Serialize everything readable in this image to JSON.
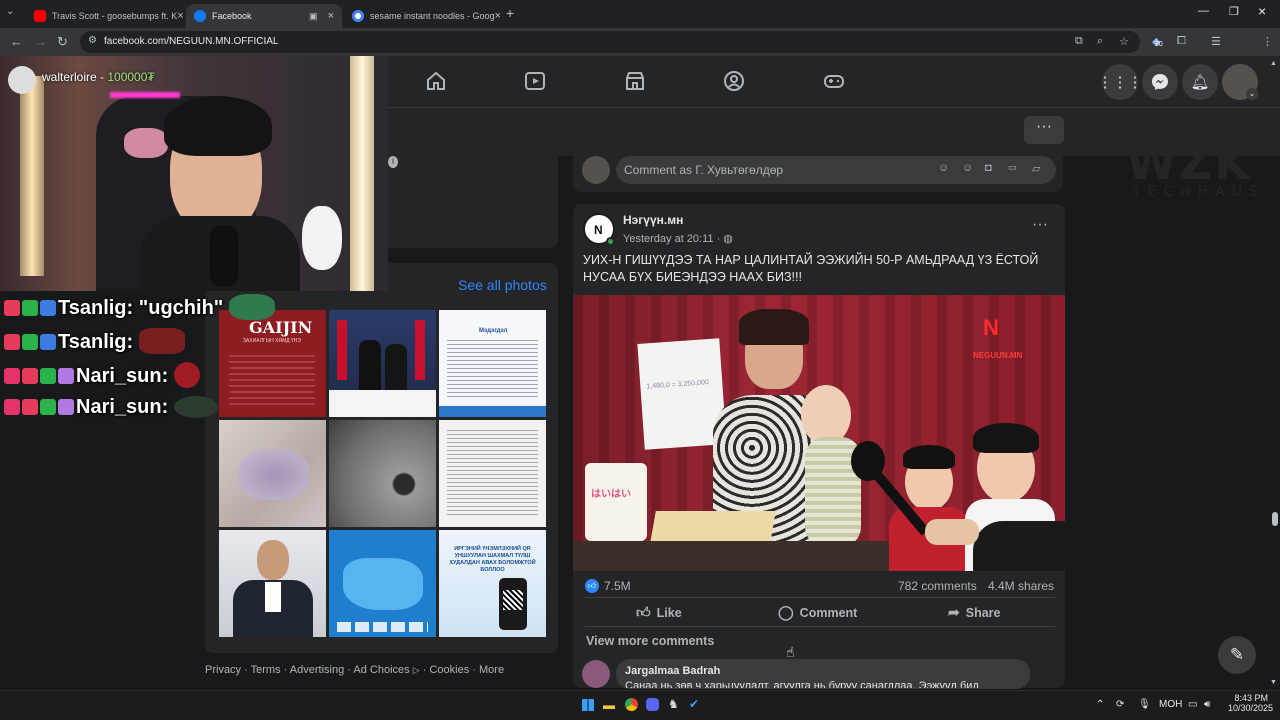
{
  "browser": {
    "tabs": [
      {
        "title": "Travis Scott - goosebumps ft. K",
        "favicon_color": "#ff0000"
      },
      {
        "title": "Facebook",
        "favicon_color": "#1877f2"
      },
      {
        "title": "sesame instant noodles - Goog",
        "favicon_color": "#4285f4"
      }
    ],
    "new_tab": "+",
    "url": "facebook.com/NEGUUN.MN.OFFICIAL",
    "extension_badge": "30"
  },
  "webcam": {
    "streamer": "walterloire",
    "balance": "100000₮"
  },
  "stream_chat": [
    {
      "user": "Tsanlig:",
      "message": "\"ugchih\""
    },
    {
      "user": "Tsanlig:",
      "message": ""
    },
    {
      "user": "Nari_sun:",
      "message": ""
    },
    {
      "user": "Nari_sun:",
      "message": ""
    }
  ],
  "photos_card": {
    "see_all": "See all photos",
    "tile1_brand": "GAIJIN",
    "tile1_sub": "ЗАХИАЛГЫН ХЯМД ҮНЭ",
    "tile3_title": "Мэдэгдэл",
    "tile8_title": "ЖАГСААЛТ",
    "tile9_title": "ИРГЭНИЙ ҮНЭМЛЭХНИЙ QR УНШУУЛАН ШАХМАЛ ТҮЛШ ХУДАЛДАН АВАХ БОЛОМЖТОЙ БОЛЛОО"
  },
  "footer": {
    "links": [
      "Privacy",
      "Terms",
      "Advertising",
      "Ad Choices",
      "Cookies",
      "More"
    ],
    "separator": "·"
  },
  "comment_box": {
    "placeholder": "Comment as Г. Хувьтөгөлдөр"
  },
  "post": {
    "page_name": "Нэгүүн.мн",
    "time": "Yesterday at 20:11",
    "text": "УИХ-Н ГИШҮҮДЭЭ ТА НАР ЦАЛИНТАЙ ЭЭЖИЙН 50-Р АМЬДРААД ҮЗ ЁСТОЙ НУСАА БҮХ БИЕЭНДЭЭ НААХ БИЗ!!!",
    "watermark": "NEGUUN.MN",
    "paper_text": "1,480,0 = 3,250,000",
    "can_label": "はいはい",
    "reactions": "7.5M",
    "comments": "782 comments",
    "shares": "4.4M shares",
    "actions": {
      "like": "Like",
      "comment": "Comment",
      "share": "Share"
    },
    "view_more": "View more comments",
    "top_comment": {
      "author": "Jargalmaa Badrah",
      "text": "Санаа нь зөв ч харьцуулалт, агуулга нь буруу санагдлаа. Ээжүүд бид"
    }
  },
  "watermark_right": {
    "line1": "WZK",
    "line2": "TECHHAUS"
  },
  "taskbar": {
    "lang": "МОН",
    "time": "8:43 PM",
    "date": "10/30/2025"
  }
}
